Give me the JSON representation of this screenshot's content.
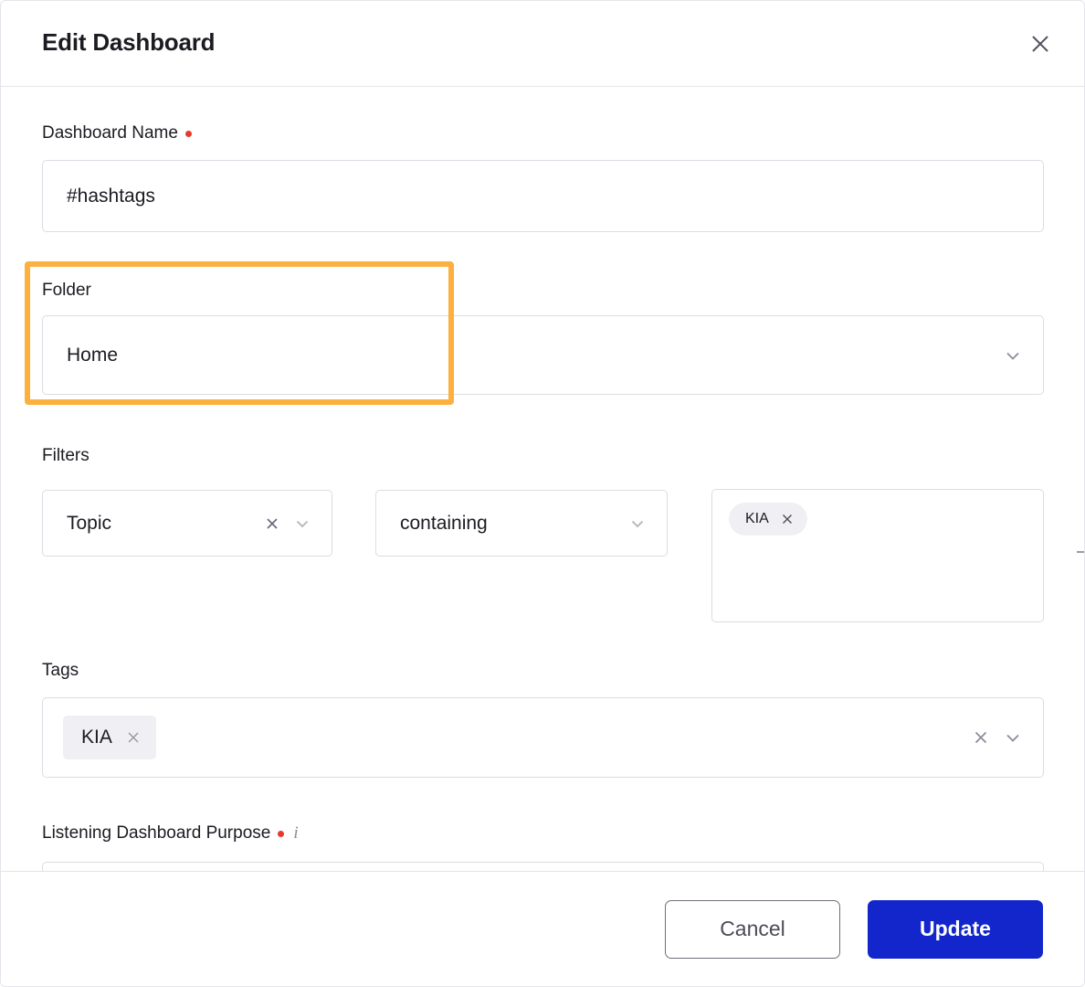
{
  "dialog": {
    "title": "Edit Dashboard",
    "close_icon": "close-icon"
  },
  "fields": {
    "dashboard_name": {
      "label": "Dashboard Name",
      "required": true,
      "value": "#hashtags",
      "placeholder": ""
    },
    "folder": {
      "label": "Folder",
      "required": false,
      "value": "Home",
      "chevron_icon": "chevron-down-icon",
      "highlighted": true
    },
    "filters": {
      "label": "Filters",
      "subject": {
        "value": "Topic",
        "clear_icon": "close-icon",
        "chevron_icon": "chevron-down-icon"
      },
      "operator": {
        "value": "containing",
        "chevron_icon": "chevron-down-icon"
      },
      "values": {
        "chips": [
          {
            "label": "KIA",
            "remove_icon": "close-icon"
          }
        ]
      },
      "add_icon": "plus-icon"
    },
    "tags": {
      "label": "Tags",
      "chips": [
        {
          "label": "KIA",
          "remove_icon": "close-icon"
        }
      ],
      "clear_icon": "close-icon",
      "chevron_icon": "chevron-down-icon"
    },
    "listening_dashboard_purpose": {
      "label": "Listening Dashboard Purpose",
      "required": true,
      "info_icon": "info-icon",
      "value": ""
    }
  },
  "footer": {
    "cancel_label": "Cancel",
    "update_label": "Update"
  },
  "colors": {
    "primary_blue": "#1226CC",
    "highlight_orange": "#FBB03F",
    "required_red": "#E8392E",
    "chip_gray": "#F0F0F4",
    "border_gray": "#DCDCE3"
  }
}
